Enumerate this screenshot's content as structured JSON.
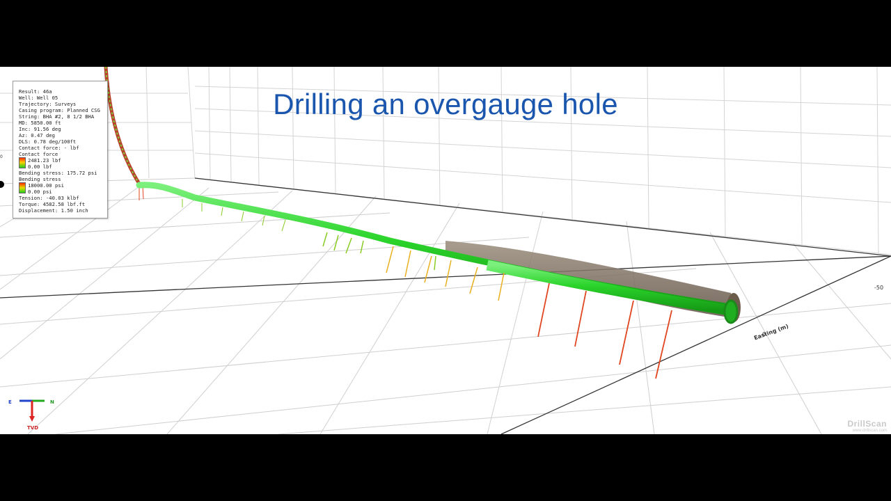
{
  "title": "Drilling an overgauge hole",
  "info_panel": {
    "result": "Result: 46a",
    "well": "Well: Well 05",
    "trajectory": "Trajectory: Surveys",
    "casing_program": "Casing program: Planned CSG",
    "string": "String: BHA #2, 8 1/2 BHA",
    "md": "MD: 5850.00 ft",
    "inc": "Inc: 91.56 deg",
    "az": "Az: 0.47 deg",
    "dls": "DLS: 0.78 deg/100ft",
    "contact_force_text": "Contact force: - lbf",
    "contact_force_label": "Contact force",
    "contact_force_max": "2481.23 lbf",
    "contact_force_min": "0.00 lbf",
    "bending_stress_text": "Bending stress: 175.72 psi",
    "bending_stress_label": "Bending stress",
    "bending_stress_max": "18000.00 psi",
    "bending_stress_min": "0.00 psi",
    "tension": "Tension: -40.03 klbf",
    "torque": "Torque: 4582.58 lbf.ft",
    "displacement": "Displacement: 1.50 inch"
  },
  "axes": {
    "e_label": "E",
    "n_label": "N",
    "tvd_label": "TVD",
    "easting_label": "Easting (m)",
    "tick_zero": "0",
    "tick_minus50": "-50",
    "left_tick": "0"
  },
  "watermark": {
    "brand": "DrillScan",
    "url": "www.drillscan.com"
  },
  "colors": {
    "title": "#1b56ae",
    "pipe": "#22cc22",
    "hole": "#7a6a5a",
    "arrow_high": "#e0451f",
    "arrow_mid": "#e8b020",
    "arrow_low": "#88cc22"
  }
}
